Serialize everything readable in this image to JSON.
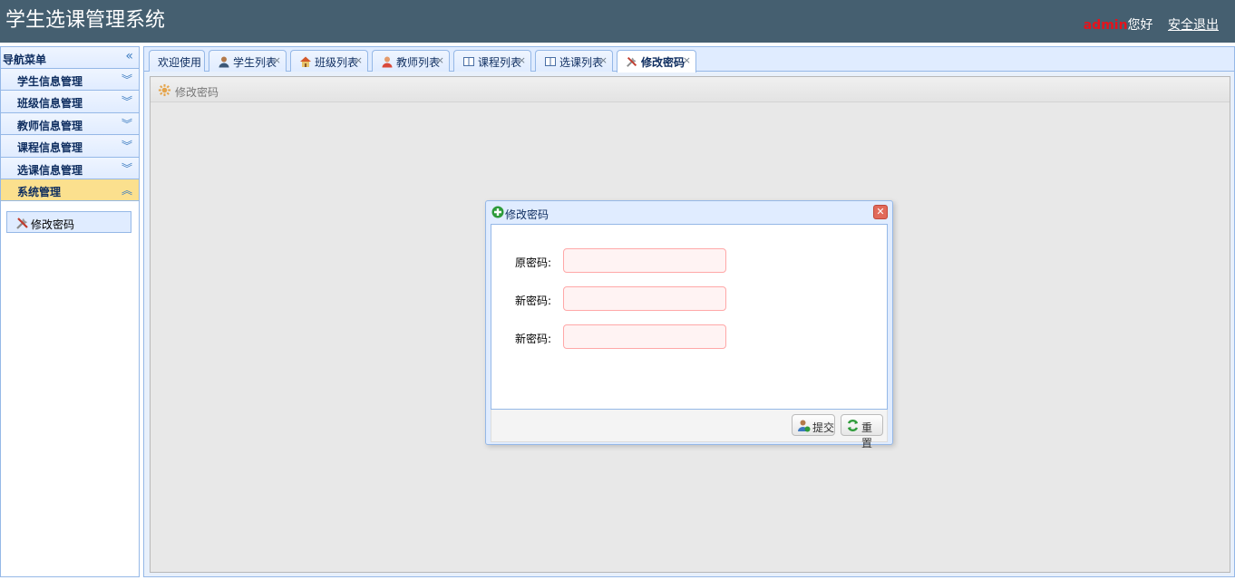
{
  "app": {
    "title": "学生选课管理系统"
  },
  "user": {
    "name": "admin",
    "greeting": "您好",
    "logout": "安全退出"
  },
  "sidebar": {
    "title": "导航菜单",
    "items": [
      {
        "label": "学生信息管理",
        "expanded": false
      },
      {
        "label": "班级信息管理",
        "expanded": false
      },
      {
        "label": "教师信息管理",
        "expanded": false
      },
      {
        "label": "课程信息管理",
        "expanded": false
      },
      {
        "label": "选课信息管理",
        "expanded": false
      },
      {
        "label": "系统管理",
        "expanded": true
      }
    ],
    "sub_items": [
      {
        "label": "修改密码",
        "icon": "wrench-icon"
      }
    ]
  },
  "tabs": [
    {
      "label": "欢迎使用",
      "icon": "",
      "closable": false
    },
    {
      "label": "学生列表",
      "icon": "student-icon",
      "closable": true
    },
    {
      "label": "班级列表",
      "icon": "house-icon",
      "closable": true
    },
    {
      "label": "教师列表",
      "icon": "teacher-icon",
      "closable": true
    },
    {
      "label": "课程列表",
      "icon": "book-icon",
      "closable": true
    },
    {
      "label": "选课列表",
      "icon": "book-icon",
      "closable": true
    },
    {
      "label": "修改密码",
      "icon": "wrench-icon",
      "closable": true,
      "active": true
    }
  ],
  "panel": {
    "title": "修改密码"
  },
  "dialog": {
    "title": "修改密码",
    "fields": [
      {
        "label": "原密码:",
        "value": ""
      },
      {
        "label": "新密码:",
        "value": ""
      },
      {
        "label": "新密码:",
        "value": ""
      }
    ],
    "buttons": {
      "submit": "提交",
      "reset": "重置"
    }
  },
  "colors": {
    "header_bg": "#455f70",
    "accent": "#95b8e7",
    "active_menu": "#fbe08e",
    "username": "#e6121b"
  }
}
